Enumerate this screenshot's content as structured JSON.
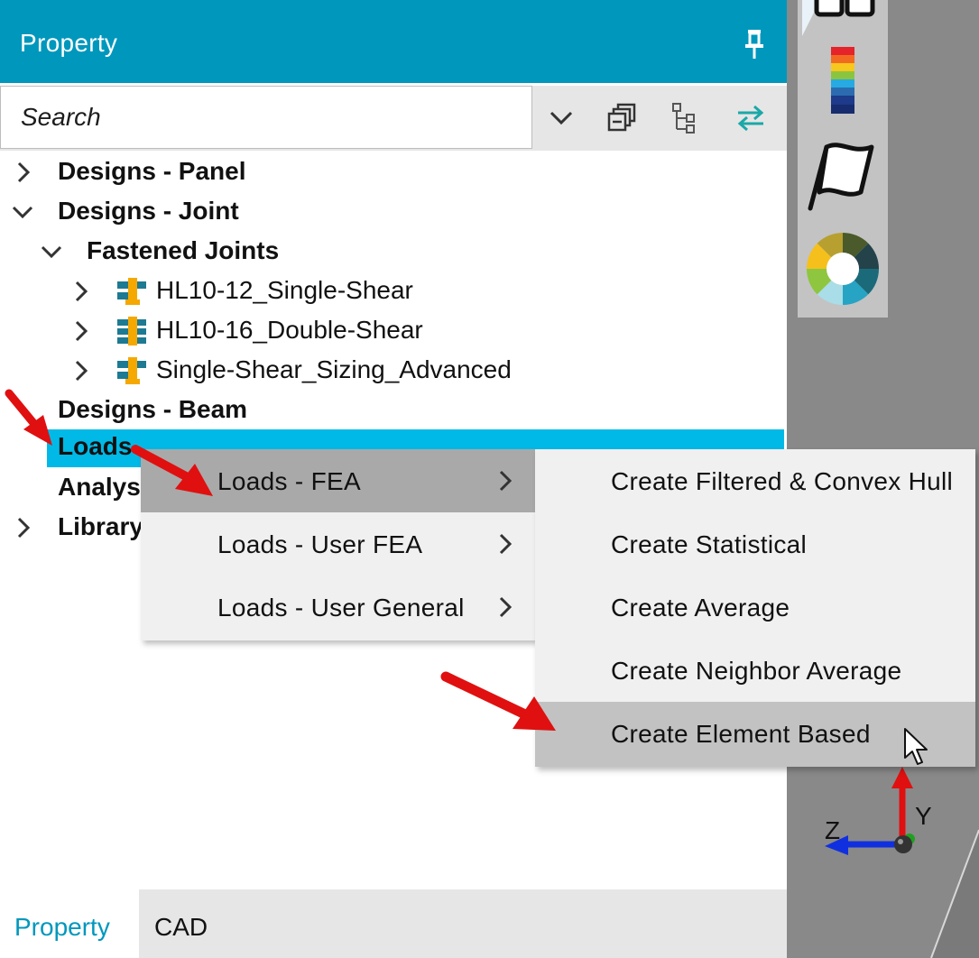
{
  "panel": {
    "title": "Property",
    "pin_icon": "pin-icon"
  },
  "search": {
    "placeholder": "Search",
    "tools": [
      "chevron-down-icon",
      "collapse-all-icon",
      "tree-view-icon",
      "sync-arrows-icon"
    ]
  },
  "tree": {
    "designs_panel": "Designs - Panel",
    "designs_joint": "Designs - Joint",
    "fastened_joints": "Fastened Joints",
    "joint_1": "HL10-12_Single-Shear",
    "joint_2": "HL10-16_Double-Shear",
    "joint_3": "Single-Shear_Sizing_Advanced",
    "designs_beam": "Designs - Beam",
    "loads": "Loads",
    "analysis": "Analysis",
    "library": "Library"
  },
  "menu1": {
    "items": [
      "Loads - FEA",
      "Loads - User FEA",
      "Loads - User General"
    ],
    "active_index": 0
  },
  "menu2": {
    "items": [
      "Create Filtered & Convex Hull",
      "Create Statistical",
      "Create Average",
      "Create Neighbor Average",
      "Create Element Based"
    ],
    "active_index": 4
  },
  "tabs": {
    "property": "Property",
    "cad": "CAD"
  },
  "viewport": {
    "tools": [
      "glasses-icon",
      "color-scale-icon",
      "flag-icon",
      "color-wheel-icon"
    ],
    "axis_z": "Z",
    "axis_y": "Y"
  },
  "colors": {
    "title_bar": "#0097bd",
    "selection": "#00b9e6",
    "menu_bg": "#f0f0f0",
    "menu_active": "#a9a9a9",
    "annotation_arrow": "#e01010"
  }
}
